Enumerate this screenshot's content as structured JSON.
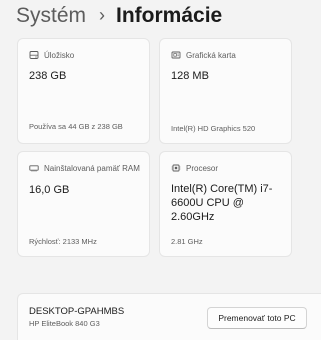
{
  "breadcrumb": {
    "parent": "Systém",
    "separator": "›",
    "current": "Informácie"
  },
  "cards": {
    "storage": {
      "label": "Úložisko",
      "icon": "storage-icon",
      "value": "238 GB",
      "detail": "Používa sa 44 GB z 238 GB"
    },
    "graphics": {
      "label": "Grafická karta",
      "icon": "graphics-card-icon",
      "value": "128 MB",
      "detail": "Intel(R) HD Graphics 520"
    },
    "ram": {
      "label": "Nainštalovaná pamäť RAM",
      "icon": "ram-icon",
      "value": "16,0 GB",
      "detail": "Rýchlosť: 2133 MHz"
    },
    "processor": {
      "label": "Procesor",
      "icon": "processor-icon",
      "value": "Intel(R) Core(TM) i7-6600U CPU @ 2.60GHz",
      "detail": "2.81 GHz"
    }
  },
  "device": {
    "name": "DESKTOP-GPAHMBS",
    "model": "HP EliteBook 840 G3",
    "rename_label": "Premenovať toto PC"
  },
  "colors": {
    "background": "#f3f3f3",
    "card": "#fbfbfb",
    "secondary_text": "#5d5d5d"
  }
}
